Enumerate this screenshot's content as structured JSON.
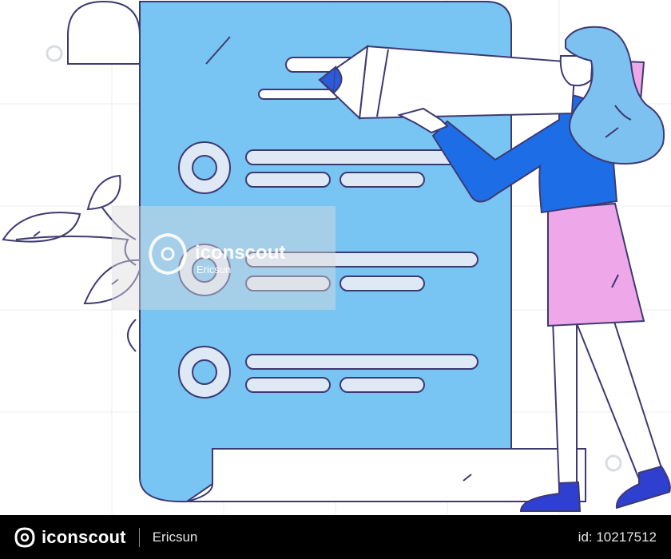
{
  "watermark": {
    "brand": "iconscout",
    "author": "Ericsun"
  },
  "footer": {
    "brand": "iconscout",
    "author": "Ericsun",
    "asset_id": "id: 10217512"
  },
  "colors": {
    "document": "#78c4f2",
    "outline": "#3d3a73",
    "field": "#dfe9f5",
    "hair": "#7dc1f0",
    "jacket": "#1d6de6",
    "skirt": "#eea8ea",
    "pencil_tip": "#2b5bd6",
    "shoe": "#2f3fd0"
  }
}
